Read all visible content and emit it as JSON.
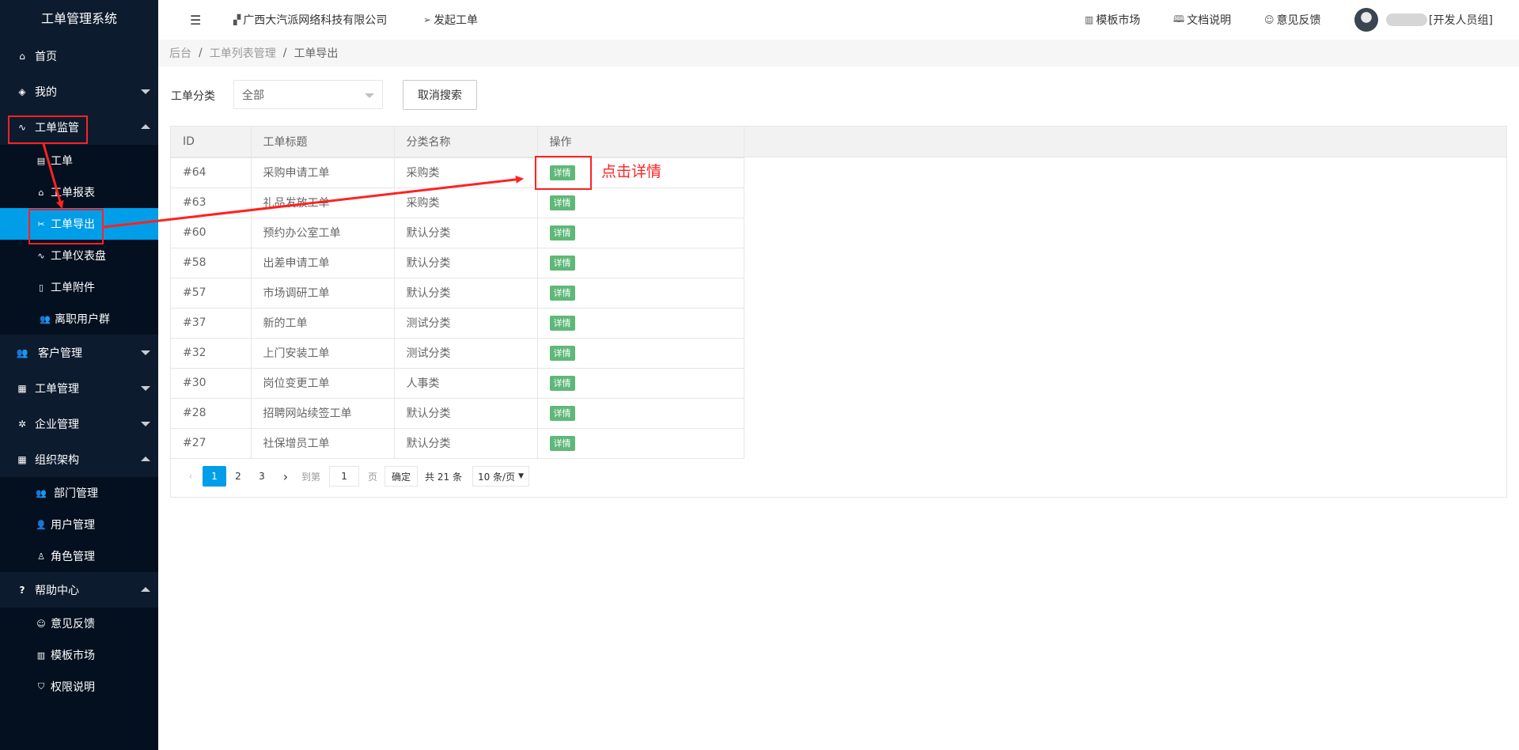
{
  "app": {
    "title": "工单管理系统"
  },
  "sidebar": {
    "items": [
      {
        "label": "首页",
        "icon": "home-icon"
      },
      {
        "label": "我的",
        "icon": "layers-icon"
      },
      {
        "label": "工单监管",
        "icon": "pulse-icon",
        "children": [
          {
            "label": "工单",
            "icon": "ticket-icon"
          },
          {
            "label": "工单报表",
            "icon": "home-icon"
          },
          {
            "label": "工单导出",
            "icon": "export-icon",
            "active": true
          },
          {
            "label": "工单仪表盘",
            "icon": "pulse-icon"
          },
          {
            "label": "工单附件",
            "icon": "file-icon"
          },
          {
            "label": "离职用户群",
            "icon": "users-icon"
          }
        ]
      },
      {
        "label": "客户管理",
        "icon": "users-icon"
      },
      {
        "label": "工单管理",
        "icon": "clipboard-icon"
      },
      {
        "label": "企业管理",
        "icon": "gear-icon"
      },
      {
        "label": "组织架构",
        "icon": "calendar-icon",
        "children": [
          {
            "label": "部门管理",
            "icon": "users-icon"
          },
          {
            "label": "用户管理",
            "icon": "user-icon"
          },
          {
            "label": "角色管理",
            "icon": "person-icon"
          }
        ]
      },
      {
        "label": "帮助中心",
        "icon": "question-icon",
        "children": [
          {
            "label": "意见反馈",
            "icon": "smile-icon"
          },
          {
            "label": "模板市场",
            "icon": "template-icon"
          },
          {
            "label": "权限说明",
            "icon": "shield-icon"
          }
        ]
      }
    ]
  },
  "topbar": {
    "menu_icon": "menu-toggle-icon",
    "company": "广西大汽派网络科技有限公司",
    "new_ticket": "发起工单",
    "template_market": "模板市场",
    "docs": "文档说明",
    "feedback": "意见反馈",
    "user_group": "[开发人员组]"
  },
  "breadcrumb": [
    "后台",
    "工单列表管理",
    "工单导出"
  ],
  "breadcrumb_sep": "/",
  "filter": {
    "label": "工单分类",
    "value": "全部",
    "cancel": "取消搜索"
  },
  "table": {
    "headers": [
      "ID",
      "工单标题",
      "分类名称",
      "操作"
    ],
    "action_label": "详情",
    "rows": [
      {
        "id": "#64",
        "title": "采购申请工单",
        "category": "采购类"
      },
      {
        "id": "#63",
        "title": "礼品发放工单",
        "category": "采购类"
      },
      {
        "id": "#60",
        "title": "预约办公室工单",
        "category": "默认分类"
      },
      {
        "id": "#58",
        "title": "出差申请工单",
        "category": "默认分类"
      },
      {
        "id": "#57",
        "title": "市场调研工单",
        "category": "默认分类"
      },
      {
        "id": "#37",
        "title": "新的工单",
        "category": "测试分类"
      },
      {
        "id": "#32",
        "title": "上门安装工单",
        "category": "测试分类"
      },
      {
        "id": "#30",
        "title": "岗位变更工单",
        "category": "人事类"
      },
      {
        "id": "#28",
        "title": "招聘网站续签工单",
        "category": "默认分类"
      },
      {
        "id": "#27",
        "title": "社保增员工单",
        "category": "默认分类"
      }
    ]
  },
  "pagination": {
    "pages": [
      "1",
      "2",
      "3"
    ],
    "current": "1",
    "goto_label": "到第",
    "goto_value": "1",
    "page_unit": "页",
    "confirm": "确定",
    "total": "共 21 条",
    "page_size": "10 条/页"
  },
  "annotation": {
    "text": "点击详情",
    "color": "#ff2222"
  },
  "colors": {
    "sidebar": "#0d1b2e",
    "accent": "#009de9",
    "badge": "#5fb878"
  }
}
